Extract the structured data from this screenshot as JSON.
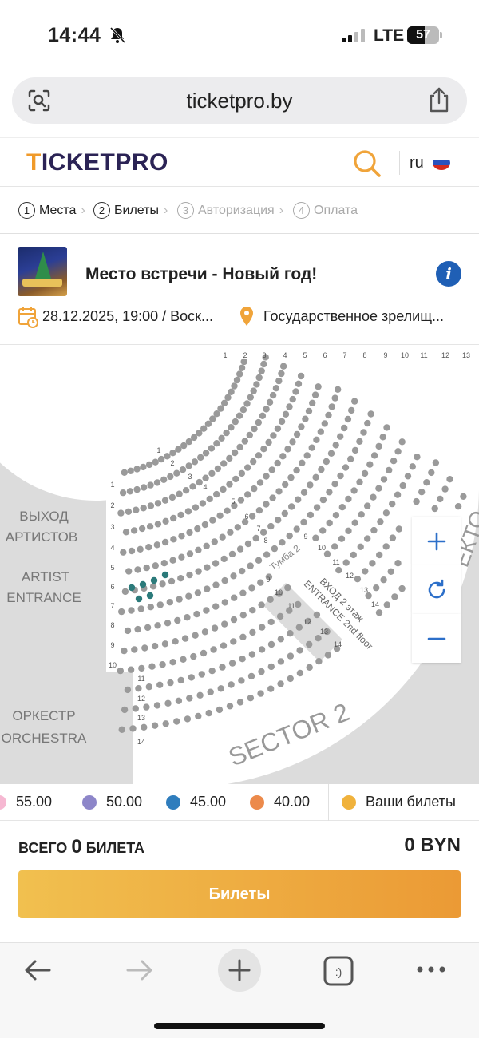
{
  "status": {
    "time": "14:44",
    "network": "LTE",
    "battery": "57"
  },
  "browser": {
    "url": "ticketpro.by"
  },
  "header": {
    "logo": "TICKETPRO",
    "lang": "ru"
  },
  "steps": [
    {
      "num": "1",
      "label": "Места",
      "active": true
    },
    {
      "num": "2",
      "label": "Билеты",
      "active": true
    },
    {
      "num": "3",
      "label": "Авторизация",
      "active": false
    },
    {
      "num": "4",
      "label": "Оплата",
      "active": false
    }
  ],
  "event": {
    "title": "Место встречи - Новый год!",
    "datetime": "28.12.2025, 19:00 / Воск...",
    "venue": "Государственное зрелищ..."
  },
  "map": {
    "labels": {
      "exit_ru": "ВЫХОД",
      "exit_ru2": "АРТИСТОВ",
      "artist": "ARTIST",
      "entrance": "ENTRANCE",
      "orchestra_ru": "ОРКЕСТР",
      "orchestra": "ORCHESTRA",
      "sector": "SECTOR 2",
      "tumba": "Тумба 2",
      "entry_ru": "ВХОД 2 этаж",
      "entry_en": "ENTRANCE 2nd floor",
      "sector_edge": "ЕКТО"
    },
    "row_numbers_left": [
      "1",
      "2",
      "3",
      "4",
      "5",
      "6",
      "7",
      "8",
      "9",
      "10",
      "11",
      "12",
      "13",
      "14"
    ],
    "row_numbers_mid": [
      "1",
      "2",
      "3",
      "4",
      "5",
      "6",
      "7",
      "8",
      "9",
      "10",
      "11",
      "12",
      "13",
      "14"
    ],
    "row_numbers_right": [
      "9",
      "10",
      "11",
      "12",
      "13",
      "14"
    ],
    "seat_numbers_top": [
      "1",
      "2",
      "3",
      "4",
      "5",
      "6",
      "7",
      "8",
      "9",
      "10",
      "11",
      "12",
      "13"
    ],
    "seat_color": "#9a9a9a",
    "selected_color": "#2b7a7a"
  },
  "legend": [
    {
      "price": "55.00",
      "color": "#f6b8d2"
    },
    {
      "price": "50.00",
      "color": "#8d86c9"
    },
    {
      "price": "45.00",
      "color": "#2f7dbd"
    },
    {
      "price": "40.00",
      "color": "#ec8a4b"
    },
    {
      "price": "Ваши билеты",
      "color": "#f0b23c"
    }
  ],
  "total": {
    "prefix": "ВСЕГО",
    "count": "0",
    "suffix": "БИЛЕТА",
    "sum": "0 BYN"
  },
  "buy_button": "Билеты"
}
